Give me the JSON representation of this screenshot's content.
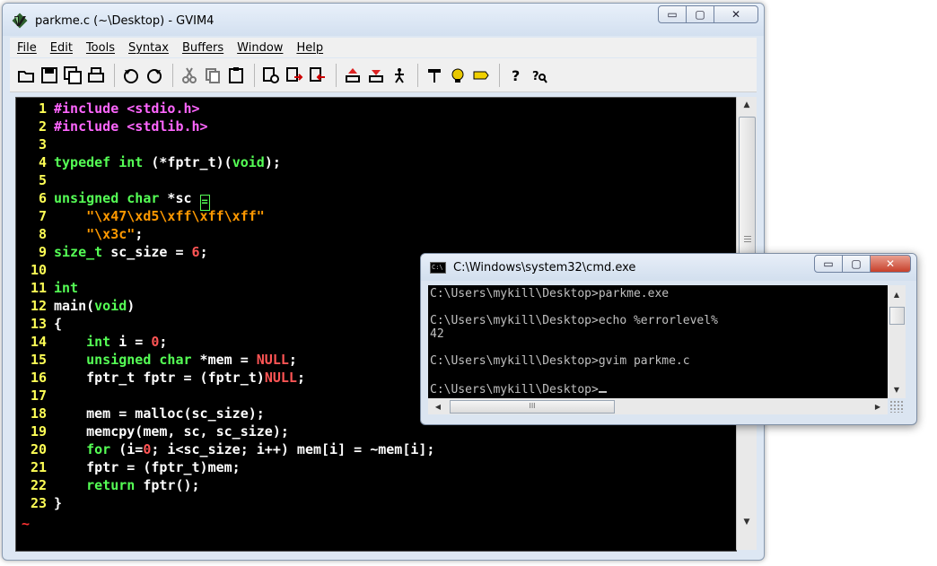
{
  "gvim": {
    "title": "parkme.c (~\\Desktop) - GVIM4",
    "caption": {
      "minimize": "▭",
      "maximize": "▢",
      "close": "✕"
    },
    "menu": [
      "File",
      "Edit",
      "Tools",
      "Syntax",
      "Buffers",
      "Window",
      "Help"
    ],
    "toolbar_icons": [
      "open-icon",
      "save-icon",
      "save-all-icon",
      "print-icon",
      "undo-icon",
      "redo-icon",
      "cut-icon",
      "copy-icon",
      "paste-icon",
      "find-replace-icon",
      "find-next-icon",
      "find-prev-icon",
      "load-session-icon",
      "save-session-icon",
      "run-script-icon",
      "make-icon",
      "build-tags-icon",
      "jump-tag-icon",
      "help-icon",
      "find-help-icon"
    ],
    "code_lines": [
      {
        "n": "1",
        "parts": [
          {
            "t": "#include <stdio.h>",
            "c": "pp"
          }
        ]
      },
      {
        "n": "2",
        "parts": [
          {
            "t": "#include <stdlib.h>",
            "c": "pp"
          }
        ]
      },
      {
        "n": "3",
        "parts": []
      },
      {
        "n": "4",
        "parts": [
          {
            "t": "typedef int",
            "c": "ty"
          },
          {
            "t": " (*fptr_t)(",
            "c": ""
          },
          {
            "t": "void",
            "c": "ty"
          },
          {
            "t": ");",
            "c": ""
          }
        ]
      },
      {
        "n": "5",
        "parts": []
      },
      {
        "n": "6",
        "parts": [
          {
            "t": "unsigned char",
            "c": "ty"
          },
          {
            "t": " *sc ",
            "c": ""
          },
          {
            "t": "=",
            "c": "cursor"
          }
        ]
      },
      {
        "n": "7",
        "parts": [
          {
            "t": "    ",
            "c": ""
          },
          {
            "t": "\"\\x47\\xd5\\xff\\xff\\xff\"",
            "c": "st"
          }
        ]
      },
      {
        "n": "8",
        "parts": [
          {
            "t": "    ",
            "c": ""
          },
          {
            "t": "\"\\x3c\"",
            "c": "st"
          },
          {
            "t": ";",
            "c": ""
          }
        ]
      },
      {
        "n": "9",
        "parts": [
          {
            "t": "size_t",
            "c": "ty"
          },
          {
            "t": " sc_size = ",
            "c": ""
          },
          {
            "t": "6",
            "c": "nu"
          },
          {
            "t": ";",
            "c": ""
          }
        ]
      },
      {
        "n": "10",
        "parts": []
      },
      {
        "n": "11",
        "parts": [
          {
            "t": "int",
            "c": "ty"
          }
        ]
      },
      {
        "n": "12",
        "parts": [
          {
            "t": "main(",
            "c": ""
          },
          {
            "t": "void",
            "c": "ty"
          },
          {
            "t": ")",
            "c": ""
          }
        ]
      },
      {
        "n": "13",
        "parts": [
          {
            "t": "{",
            "c": ""
          }
        ]
      },
      {
        "n": "14",
        "parts": [
          {
            "t": "    ",
            "c": ""
          },
          {
            "t": "int",
            "c": "ty"
          },
          {
            "t": " i = ",
            "c": ""
          },
          {
            "t": "0",
            "c": "nu"
          },
          {
            "t": ";",
            "c": ""
          }
        ]
      },
      {
        "n": "15",
        "parts": [
          {
            "t": "    ",
            "c": ""
          },
          {
            "t": "unsigned char",
            "c": "ty"
          },
          {
            "t": " *mem = ",
            "c": ""
          },
          {
            "t": "NULL",
            "c": "nu"
          },
          {
            "t": ";",
            "c": ""
          }
        ]
      },
      {
        "n": "16",
        "parts": [
          {
            "t": "    fptr_t fptr = (fptr_t)",
            "c": ""
          },
          {
            "t": "NULL",
            "c": "nu"
          },
          {
            "t": ";",
            "c": ""
          }
        ]
      },
      {
        "n": "17",
        "parts": []
      },
      {
        "n": "18",
        "parts": [
          {
            "t": "    mem = malloc(sc_size);",
            "c": ""
          }
        ]
      },
      {
        "n": "19",
        "parts": [
          {
            "t": "    memcpy(mem, sc, sc_size);",
            "c": ""
          }
        ]
      },
      {
        "n": "20",
        "parts": [
          {
            "t": "    ",
            "c": ""
          },
          {
            "t": "for",
            "c": "ty"
          },
          {
            "t": " (i=",
            "c": ""
          },
          {
            "t": "0",
            "c": "nu"
          },
          {
            "t": "; i<sc_size; i++) mem[i] = ~mem[i];",
            "c": ""
          }
        ]
      },
      {
        "n": "21",
        "parts": [
          {
            "t": "    fptr = (fptr_t)mem;",
            "c": ""
          }
        ]
      },
      {
        "n": "22",
        "parts": [
          {
            "t": "    ",
            "c": ""
          },
          {
            "t": "return",
            "c": "ty"
          },
          {
            "t": " fptr();",
            "c": ""
          }
        ]
      },
      {
        "n": "23",
        "parts": [
          {
            "t": "}",
            "c": ""
          }
        ]
      }
    ],
    "tilde": "~",
    "colors": {
      "background": "#000000",
      "linenr": "#ffff55",
      "preproc": "#ff66ff",
      "type": "#55ff55",
      "string": "#ff9900",
      "number": "#ff5555"
    }
  },
  "cmd": {
    "title": "C:\\Windows\\system32\\cmd.exe",
    "icon_text": "C:\\",
    "caption": {
      "minimize": "▭",
      "maximize": "▢",
      "close": "✕"
    },
    "lines": [
      "C:\\Users\\mykill\\Desktop>parkme.exe",
      "",
      "C:\\Users\\mykill\\Desktop>echo %errorlevel%",
      "42",
      "",
      "C:\\Users\\mykill\\Desktop>gvim parkme.c",
      "",
      "C:\\Users\\mykill\\Desktop>"
    ],
    "hscroll_grip": "III"
  }
}
